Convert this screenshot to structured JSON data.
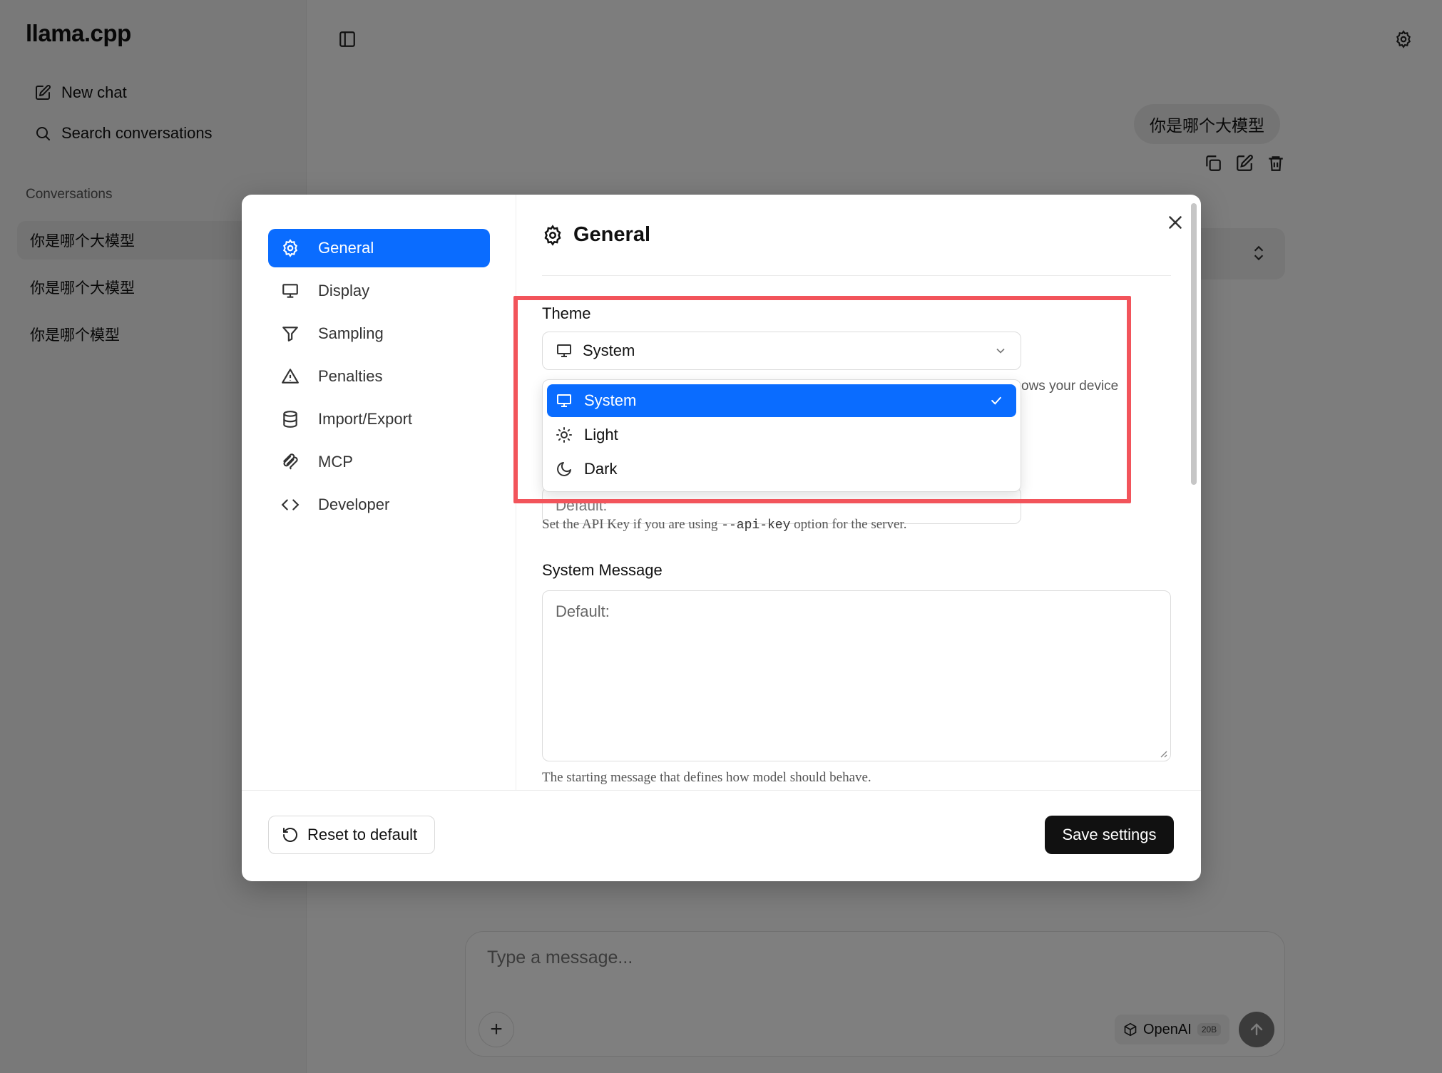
{
  "app": {
    "title": "llama.cpp",
    "new_chat": "New chat",
    "search": "Search conversations",
    "conversations_heading": "Conversations",
    "conversations": [
      "你是哪个大模型",
      "你是哪个大模型",
      "你是哪个模型"
    ]
  },
  "chat": {
    "user_message": "你是哪个大模型",
    "composer_placeholder": "Type a message...",
    "model_name": "OpenAI",
    "model_badge": "20B"
  },
  "settings": {
    "nav": [
      {
        "label": "General",
        "icon": "gear-icon",
        "active": true
      },
      {
        "label": "Display",
        "icon": "monitor-icon"
      },
      {
        "label": "Sampling",
        "icon": "filter-icon"
      },
      {
        "label": "Penalties",
        "icon": "warning-icon"
      },
      {
        "label": "Import/Export",
        "icon": "database-icon"
      },
      {
        "label": "MCP",
        "icon": "mcp-icon"
      },
      {
        "label": "Developer",
        "icon": "code-icon"
      }
    ],
    "section_title": "General",
    "theme": {
      "label": "Theme",
      "value": "System",
      "help_fragment": "ows your device",
      "options": [
        {
          "label": "System",
          "icon": "monitor-icon",
          "selected": true
        },
        {
          "label": "Light",
          "icon": "sun-icon"
        },
        {
          "label": "Dark",
          "icon": "moon-icon"
        }
      ]
    },
    "api_key": {
      "placeholder": "Default:",
      "help_pre": "Set the API Key if you are using ",
      "help_code": "--api-key",
      "help_post": " option for the server."
    },
    "system_message": {
      "label": "System Message",
      "placeholder": "Default:",
      "help": "The starting message that defines how model should behave."
    },
    "reset_label": "Reset to default",
    "save_label": "Save settings"
  },
  "colors": {
    "accent": "#0a6cff",
    "highlight": "#f2545b",
    "primary_button": "#111111"
  }
}
